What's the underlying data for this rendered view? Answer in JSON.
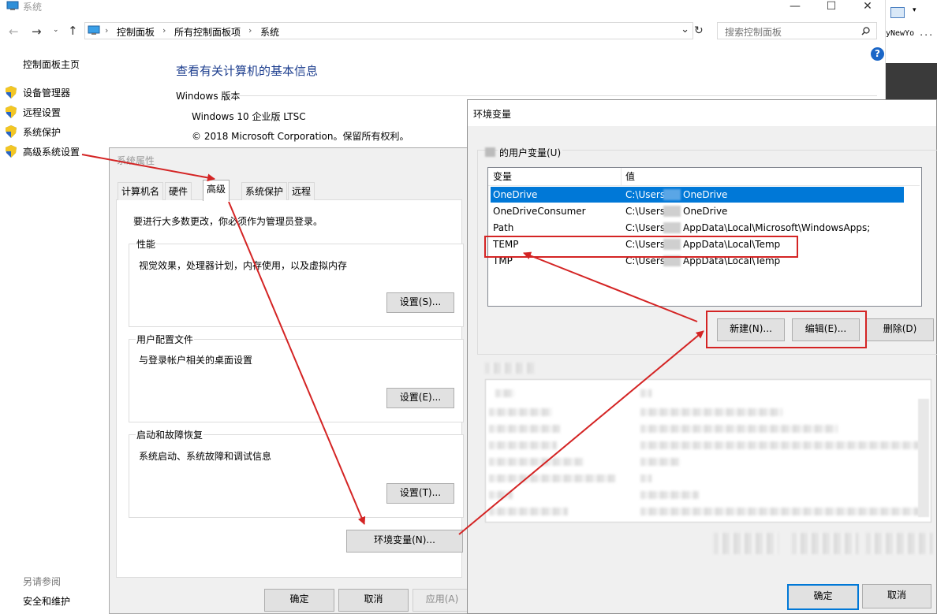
{
  "window": {
    "title": "系统",
    "caption": {
      "minimize": "—",
      "maximize": "☐",
      "close": "✕"
    }
  },
  "address_bar": {
    "crumbs": [
      "控制面板",
      "所有控制面板项",
      "系统"
    ],
    "search_placeholder": "搜索控制面板"
  },
  "right_strip": {
    "text": "yNewYo ..."
  },
  "sidebar": {
    "home_link": "控制面板主页",
    "items": [
      {
        "label": "设备管理器",
        "icon": "shield-icon"
      },
      {
        "label": "远程设置",
        "icon": "shield-icon"
      },
      {
        "label": "系统保护",
        "icon": "shield-icon"
      },
      {
        "label": "高级系统设置",
        "icon": "shield-icon"
      }
    ],
    "see_also": "另请参阅",
    "security_link": "安全和维护"
  },
  "main": {
    "heading": "查看有关计算机的基本信息",
    "windows_edition_label": "Windows 版本",
    "edition": "Windows 10 企业版 LTSC",
    "copyright": "© 2018 Microsoft Corporation。保留所有权利。"
  },
  "sys_props": {
    "title": "系统属性",
    "tabs": [
      "计算机名",
      "硬件",
      "高级",
      "系统保护",
      "远程"
    ],
    "admin_note": "要进行大多数更改，你必须作为管理员登录。",
    "performance": {
      "label": "性能",
      "desc": "视觉效果，处理器计划，内存使用，以及虚拟内存",
      "button": "设置(S)..."
    },
    "profiles": {
      "label": "用户配置文件",
      "desc": "与登录帐户相关的桌面设置",
      "button": "设置(E)..."
    },
    "startup": {
      "label": "启动和故障恢复",
      "desc": "系统启动、系统故障和调试信息",
      "button": "设置(T)..."
    },
    "env_button": "环境变量(N)...",
    "ok": "确定",
    "cancel": "取消",
    "apply": "应用(A)"
  },
  "env_vars": {
    "title": "环境变量",
    "user_group_label": "的用户变量(U)",
    "columns": [
      "变量",
      "值"
    ],
    "rows": [
      {
        "name": "OneDrive",
        "value_prefix": "C:\\Users",
        "value_suffix": "OneDrive"
      },
      {
        "name": "OneDriveConsumer",
        "value_prefix": "C:\\Users",
        "value_suffix": "OneDrive"
      },
      {
        "name": "Path",
        "value_prefix": "C:\\Users",
        "value_suffix": "AppData\\Local\\Microsoft\\WindowsApps;"
      },
      {
        "name": "TEMP",
        "value_prefix": "C:\\Users",
        "value_suffix": "AppData\\Local\\Temp"
      },
      {
        "name": "TMP",
        "value_prefix": "C:\\Users",
        "value_suffix": "AppData\\Local\\Temp"
      }
    ],
    "new_button": "新建(N)...",
    "edit_button": "编辑(E)...",
    "delete_button": "删除(D)",
    "ok": "确定",
    "cancel": "取消"
  },
  "colors": {
    "annotation_red": "#d42424",
    "selection_blue": "#0078d7",
    "link_blue": "#1e3f8f"
  }
}
